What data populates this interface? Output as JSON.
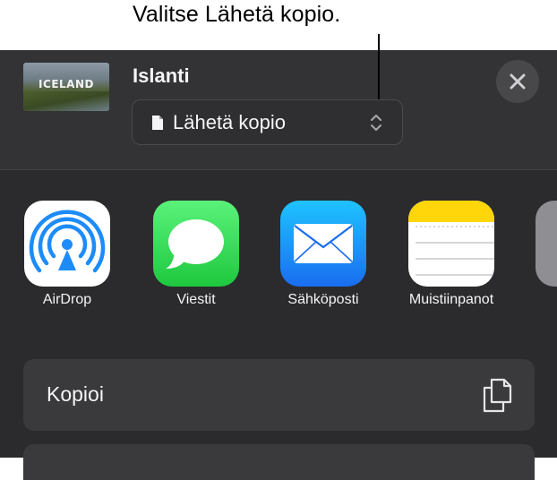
{
  "callout": {
    "text": "Valitse Lähetä kopio."
  },
  "header": {
    "title": "Islanti",
    "thumbnail_text": "ICELAND",
    "dropdown_label": "Lähetä kopio"
  },
  "apps": [
    {
      "label": "AirDrop",
      "icon": "airdrop-icon"
    },
    {
      "label": "Viestit",
      "icon": "messages-icon"
    },
    {
      "label": "Sähköposti",
      "icon": "mail-icon"
    },
    {
      "label": "Muistiinpanot",
      "icon": "notes-icon"
    }
  ],
  "actions": {
    "copy_label": "Kopioi"
  },
  "colors": {
    "sheet_bg": "#2b2b2d",
    "header_bg": "#333336",
    "row_bg": "#3a3a3c",
    "messages_green": "#34c759",
    "mail_blue": "#1a82fb",
    "airdrop_blue": "#1d8cf8",
    "notes_yellow": "#ffd60a"
  }
}
